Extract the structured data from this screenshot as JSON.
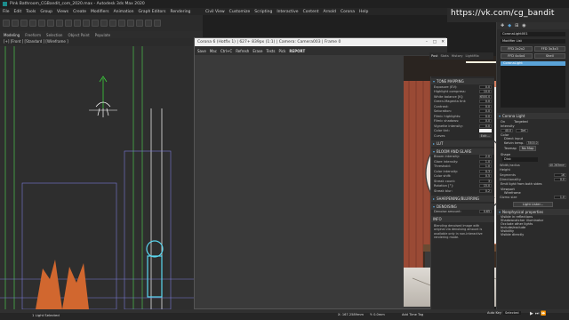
{
  "window": {
    "title": "Pink Bathroom_CGBandit_com_2020.max - Autodesk 3ds Max 2020"
  },
  "menu": [
    "File",
    "Edit",
    "Tools",
    "Group",
    "Views",
    "Create",
    "Modifiers",
    "Animation",
    "Graph Editors",
    "Rendering",
    "Civil View",
    "Customize",
    "Scripting",
    "Interactive",
    "Content",
    "Arnold",
    "Corona",
    "Help"
  ],
  "ribbon": [
    "Modeling",
    "Freeform",
    "Selection",
    "Object Paint",
    "Populate"
  ],
  "viewport": {
    "label": "[+] [Front ] [Standard ] [Wireframe ]"
  },
  "status": {
    "left": "1 Light Selected",
    "add_time_tag": "Add Time Tag",
    "auto_key": "Auto Key",
    "selected": "Selected",
    "x": "X: 167.2589mm",
    "y": "Y: 0.0mm"
  },
  "frame": {
    "title": "Corona 6 (Hotfix 1) | 627+ 839px (1:1) | Camera: Camera003 | Frame 0",
    "toolbar": [
      "Save",
      "Mac",
      "Ctrl+C",
      "Refresh",
      "Erase",
      "Tests",
      "Pick",
      "REPORT"
    ],
    "top_tabs": [
      "Post",
      "Stats",
      "History",
      "LightMix"
    ],
    "top_tools": [
      "Post",
      "Save.."
    ]
  },
  "post": {
    "tone_mapping": "TONE MAPPING",
    "tm_rows": [
      {
        "label": "Exposure (EV):",
        "value": "0.0"
      },
      {
        "label": "Highlight compress:",
        "value": "10.0"
      },
      {
        "label": "White balance [K]:",
        "value": "6500.0"
      },
      {
        "label": "Green-Magenta tint:",
        "value": "0.0"
      },
      {
        "label": "Contrast:",
        "value": "0.0"
      },
      {
        "label": "Saturation:",
        "value": "0.0"
      },
      {
        "label": "Filmic highlights:",
        "value": "0.0"
      },
      {
        "label": "Filmic shadows:",
        "value": "0.0"
      },
      {
        "label": "Vignette intensity:",
        "value": "0.0"
      },
      {
        "label": "Color tint:",
        "value": ""
      }
    ],
    "curves": "Curves",
    "edit": "Edit...",
    "lut": "LUT",
    "bloom": "BLOOM AND GLARE",
    "bloom_rows": [
      {
        "label": "Bloom intensity:",
        "value": "2.0"
      },
      {
        "label": "Glare intensity:",
        "value": "1.0"
      },
      {
        "label": "Threshold:",
        "value": "1.0"
      },
      {
        "label": "Color intensity:",
        "value": "0.3"
      },
      {
        "label": "Color shift:",
        "value": "0.5"
      },
      {
        "label": "Streak count:",
        "value": "3"
      },
      {
        "label": "Rotation [°]:",
        "value": "15.0"
      },
      {
        "label": "Streak blur:",
        "value": "0.2"
      }
    ],
    "sharpening": "SHARPENING/BLURRING",
    "denoising": "DENOISING",
    "denoise_amount": {
      "label": "Denoise amount:",
      "value": "0.65"
    },
    "info_title": "INFO",
    "info": "Blending denoised image with original via denoising amount is available only in non-interactive rendering mode."
  },
  "cmd": {
    "watermark": "https://vk.com/cg_bandit",
    "obj_name": "CoronaLight001",
    "modifier_list": "Modifier List",
    "mods": [
      "FFD 2x2x2",
      "FFD 3x3x3",
      "FFD 4x4x4",
      "Shell"
    ],
    "stack_item": "CoronaLight",
    "rollout": "Corona Light",
    "on": "On",
    "targeted": "Targeted",
    "intensity": "Intensity",
    "intensity_val": "40.0",
    "intensity_unit": "Def.",
    "color": "Color",
    "direct_input": "Direct input",
    "kelvin": "Kelvin temp.",
    "kelvin_val": "3500.0",
    "texmap": "Texmap",
    "none": "No Map",
    "shape": "Shape",
    "shape_val": "Disk",
    "width_radius": "Width/radius",
    "width_val": "40.263mm",
    "height": "Height",
    "segments": "Segments",
    "segments_val": "16",
    "directionality": "Directionality",
    "dir_val": "0.0",
    "emit_both": "Emit light from both sides",
    "viewport": "Viewport",
    "wireframe": "Wireframe",
    "gizmo_size": "Gizmo size",
    "gizmo_val": "1.0",
    "light_lister": "Light Lister...",
    "nonphysical": "Nonphysical properties",
    "visible_to": "Visible in reflections",
    "shadowcatcher": "Shadowcatcher illuminator",
    "occlude": "Occlude other lights",
    "include": "Include/exclude",
    "visibility": "Visibility",
    "visible_directly": "Visible directly"
  },
  "colors": {
    "wall": "#d27c60",
    "accent": "#5aa3d8",
    "panel": "#2a2a2a",
    "vfb_title": "#f0f0f0"
  }
}
